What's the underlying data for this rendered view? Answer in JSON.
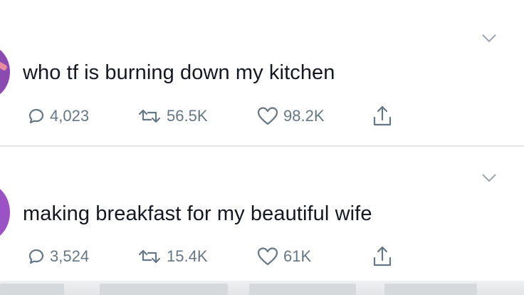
{
  "tweets": [
    {
      "text": "who tf is burning down my kitchen",
      "replies": "4,023",
      "retweets": "56.5K",
      "likes": "98.2K",
      "avatar_color": "#8a4bb0"
    },
    {
      "text": "making breakfast for my beautiful wife",
      "replies": "3,524",
      "retweets": "15.4K",
      "likes": "61K",
      "avatar_color": "#9a52c4"
    }
  ],
  "icons": {
    "reply": "reply-icon",
    "retweet": "retweet-icon",
    "like": "heart-icon",
    "share": "share-icon",
    "menu": "chevron-down-icon"
  },
  "colors": {
    "text": "#141823",
    "meta": "#657786",
    "divider": "#e3e6e9"
  }
}
